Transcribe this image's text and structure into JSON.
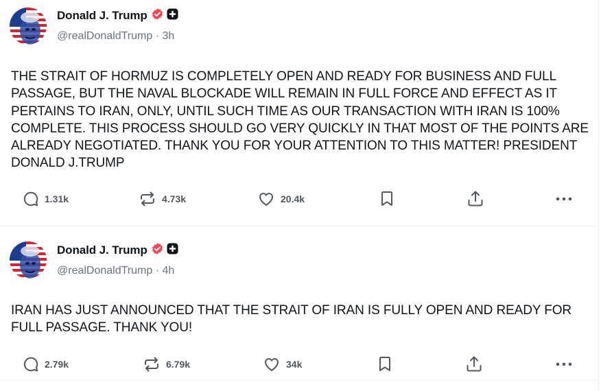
{
  "posts": [
    {
      "author": {
        "name": "Donald J. Trump",
        "handle": "@realDonaldTrump",
        "time": "3h"
      },
      "text": "THE STRAIT OF HORMUZ IS COMPLETELY OPEN AND READY FOR BUSINESS AND FULL PASSAGE, BUT THE NAVAL BLOCKADE WILL REMAIN IN FULL FORCE AND EFFECT AS IT PERTAINS TO IRAN, ONLY, UNTIL SUCH TIME AS OUR TRANSACTION WITH IRAN IS 100% COMPLETE. THIS PROCESS SHOULD GO VERY QUICKLY IN THAT MOST OF THE POINTS ARE ALREADY NEGOTIATED. THANK YOU FOR YOUR ATTENTION TO THIS MATTER! PRESIDENT DONALD J.TRUMP",
      "stats": {
        "replies": "1.31k",
        "reposts": "4.73k",
        "likes": "20.4k"
      }
    },
    {
      "author": {
        "name": "Donald J. Trump",
        "handle": "@realDonaldTrump",
        "time": "4h"
      },
      "text": "IRAN HAS JUST ANNOUNCED THAT THE STRAIT OF IRAN IS FULLY OPEN AND READY FOR FULL PASSAGE. THANK YOU!",
      "stats": {
        "replies": "2.79k",
        "reposts": "6.79k",
        "likes": "34k"
      }
    }
  ],
  "icons": {
    "reply": "reply-bubble-icon",
    "repost": "repost-arrows-icon",
    "like": "heart-icon",
    "bookmark": "bookmark-icon",
    "share": "share-upload-icon",
    "more": "more-dots-icon",
    "verified": "verified-badge-icon",
    "plus": "plus-badge-icon"
  },
  "colors": {
    "verified": "#f2465b",
    "text": "#0f1419",
    "muted": "#6b7280",
    "icon": "#50575f",
    "divider": "#eaecef"
  }
}
